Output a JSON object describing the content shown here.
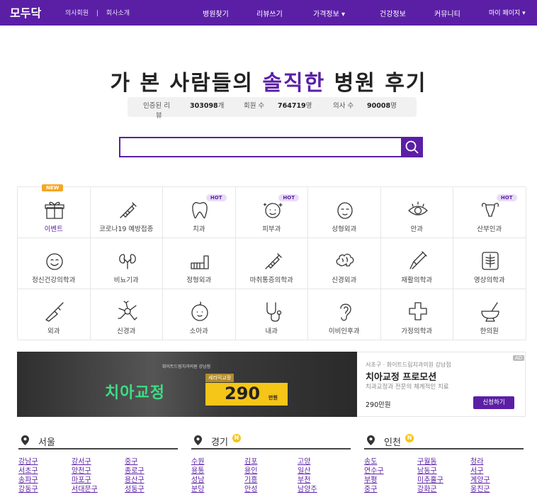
{
  "nav": {
    "logo": "모두닥",
    "sub_links": [
      "의사회원",
      "|",
      "회사소개"
    ],
    "menu": [
      "병원찾기",
      "리뷰쓰기",
      "가격정보 ▾",
      "건강정보",
      "커뮤니티",
      "마이 페이지 ▾"
    ]
  },
  "hero": {
    "title_before": "가 본 사람들의",
    "title_highlight": "솔직한",
    "title_after": "병원 후기"
  },
  "stats": {
    "review_label_1": "인증된 리",
    "review_label_2": "뷰",
    "review_value": "303098",
    "review_unit": "개",
    "member_label": "회원 수",
    "member_value": "764719",
    "member_unit": "명",
    "doctor_label": "의사 수",
    "doctor_value": "90008",
    "doctor_unit": "명"
  },
  "search": {
    "icon": "search-icon"
  },
  "categories": [
    {
      "label": "이벤트",
      "badge": "NEW",
      "icon": "gift-icon"
    },
    {
      "label": "코로나19 예방접종",
      "badge": "",
      "icon": "syringe-icon"
    },
    {
      "label": "치과",
      "badge": "HOT",
      "icon": "tooth-icon"
    },
    {
      "label": "피부과",
      "badge": "HOT",
      "icon": "face-sparkle-icon"
    },
    {
      "label": "성형외과",
      "badge": "",
      "icon": "face-icon"
    },
    {
      "label": "안과",
      "badge": "",
      "icon": "eye-icon"
    },
    {
      "label": "산부인과",
      "badge": "HOT",
      "icon": "uterus-icon"
    },
    {
      "label": "정신건강의학과",
      "badge": "",
      "icon": "smile-face-icon"
    },
    {
      "label": "비뇨기과",
      "badge": "",
      "icon": "kidney-icon"
    },
    {
      "label": "정형외과",
      "badge": "",
      "icon": "cast-icon"
    },
    {
      "label": "마취통증의학과",
      "badge": "",
      "icon": "syringe-icon"
    },
    {
      "label": "신경외과",
      "badge": "",
      "icon": "brain-icon"
    },
    {
      "label": "재활의학과",
      "badge": "",
      "icon": "crutch-icon"
    },
    {
      "label": "영상의학과",
      "badge": "",
      "icon": "xray-icon"
    },
    {
      "label": "외과",
      "badge": "",
      "icon": "scalpel-icon"
    },
    {
      "label": "신경과",
      "badge": "",
      "icon": "neuron-icon"
    },
    {
      "label": "소아과",
      "badge": "",
      "icon": "baby-icon"
    },
    {
      "label": "내과",
      "badge": "",
      "icon": "stethoscope-icon"
    },
    {
      "label": "이비인후과",
      "badge": "",
      "icon": "ear-icon"
    },
    {
      "label": "가정의학과",
      "badge": "",
      "icon": "cross-icon"
    },
    {
      "label": "한의원",
      "badge": "",
      "icon": "mortar-icon"
    }
  ],
  "ad": {
    "image_small_text": "화이트드림치과의원 강남점",
    "image_big_text": "치아교정",
    "image_tag": "세라믹교정",
    "image_price": "290",
    "image_won": "만원",
    "location": "서초구 · 화이트드림치과의원 강남점",
    "title": "치아교정 프로모션",
    "desc": "치과교정과 전문의 체계적인 치료",
    "price": "290만원",
    "button": "신청하기",
    "mark": "AD"
  },
  "regions": [
    {
      "name": "서울",
      "new": false,
      "links": [
        "강남구",
        "강서구",
        "중구",
        "서초구",
        "양천구",
        "종로구",
        "송파구",
        "마포구",
        "용산구",
        "강동구",
        "서대문구",
        "성동구"
      ]
    },
    {
      "name": "경기",
      "new": true,
      "new_mark": "N",
      "links": [
        "수원",
        "김포",
        "고양",
        "용통",
        "용인",
        "일산",
        "성남",
        "기흥",
        "부천",
        "분당",
        "안성",
        "남양주"
      ]
    },
    {
      "name": "인천",
      "new": true,
      "new_mark": "N",
      "links": [
        "송도",
        "구월동",
        "청라",
        "연수구",
        "남동구",
        "서구",
        "부평",
        "미추홀구",
        "계양구",
        "중구",
        "강화군",
        "옹진군"
      ]
    }
  ],
  "colors": {
    "brand": "#5b1fa6",
    "hot_badge": "#e8dcf7",
    "new_badge": "#f5a623"
  }
}
